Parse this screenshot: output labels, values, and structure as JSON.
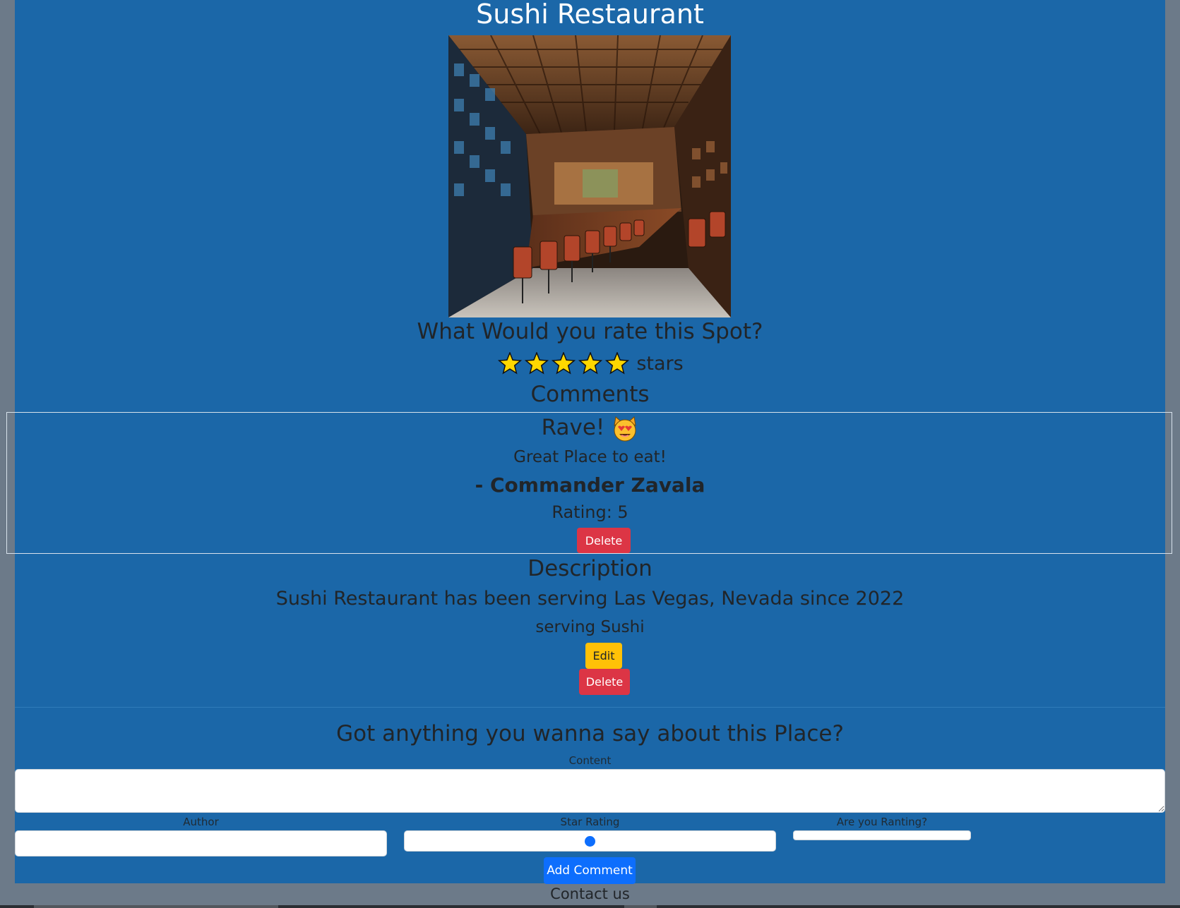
{
  "place": {
    "name": "Sushi Restaurant",
    "rating_prompt": "What Would you rate this Spot?",
    "star_rating": 5,
    "stars_label": "stars",
    "description_heading": "Description",
    "description": "Sushi Restaurant has been serving Las Vegas, Nevada since 2022",
    "cuisine_line": "serving Sushi",
    "edit_label": "Edit",
    "delete_label": "Delete"
  },
  "comments": {
    "heading": "Comments",
    "items": [
      {
        "title": "Rave!",
        "content": "Great Place to eat!",
        "author_line": "- Commander Zavala",
        "rating_line": "Rating: 5",
        "delete_label": "Delete"
      }
    ]
  },
  "form": {
    "heading": "Got anything you wanna say about this Place?",
    "content_label": "Content",
    "content_value": "",
    "author_label": "Author",
    "author_value": "",
    "star_rating_label": "Star Rating",
    "star_rating_value_fraction": 0.5,
    "rant_label": "Are you Ranting?",
    "submit_label": "Add Comment"
  },
  "footer": {
    "contact_label": "Contact us"
  },
  "colors": {
    "page_bg": "#1b67a8",
    "outer_bg": "#6c7a89",
    "danger": "#dc3545",
    "warning": "#ffc107",
    "primary": "#0d6efd",
    "star": "#ffd700"
  },
  "icons": {
    "star": "star-icon",
    "rave": "heart-eyes-cat-icon"
  }
}
